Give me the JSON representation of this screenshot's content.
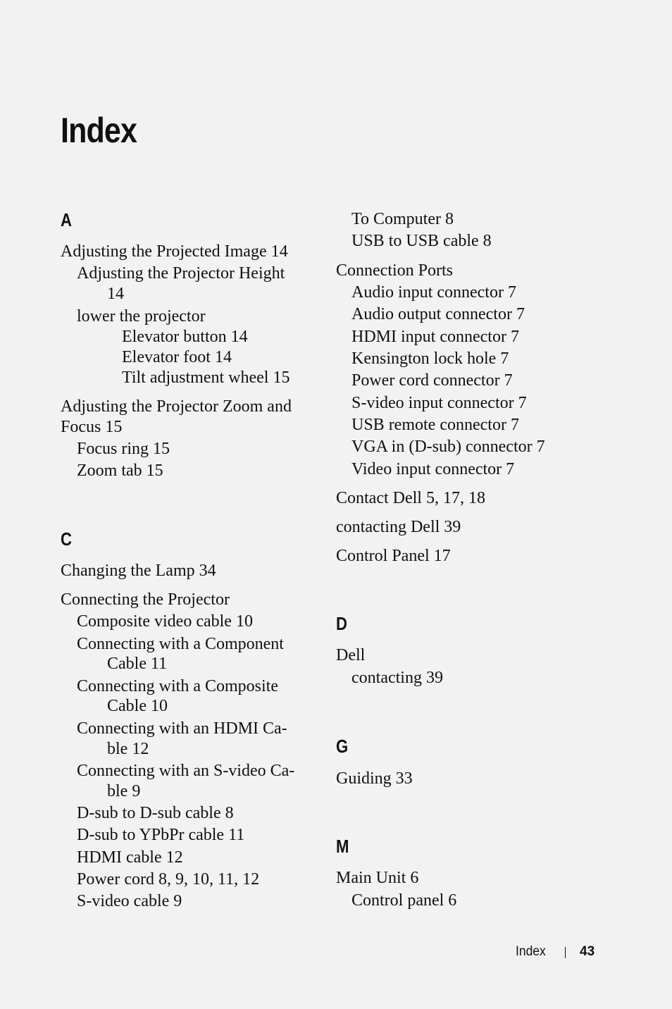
{
  "title": "Index",
  "sections": {
    "A": {
      "letter": "A",
      "lines": [
        "Adjusting the Projected Image 14",
        "Adjusting the Projector Height",
        "14",
        "lower the projector",
        "Elevator button 14",
        "Elevator foot 14",
        "Tilt adjustment wheel 15",
        "Adjusting the Projector Zoom and",
        "Focus 15",
        "Focus ring 15",
        "Zoom tab 15"
      ]
    },
    "C": {
      "letter": "C",
      "lines": [
        "Changing the Lamp 34",
        "Connecting the Projector",
        "Composite video cable 10",
        "Connecting with a Component",
        "Cable 11",
        "Connecting with a Composite",
        "Cable 10",
        "Connecting with an HDMI Ca-",
        "ble 12",
        "Connecting with an S-video Ca-",
        "ble 9",
        "D-sub to D-sub cable 8",
        "D-sub to YPbPr cable 11",
        "HDMI cable 12",
        "Power cord 8, 9, 10, 11, 12",
        "S-video cable 9",
        "To Computer 8",
        "USB to USB cable 8",
        "Connection Ports",
        "Audio input connector 7",
        "Audio output connector 7",
        "HDMI input connector 7",
        "Kensington lock hole 7",
        "Power cord connector 7",
        "S-video input connector 7",
        "USB remote connector 7",
        "VGA in (D-sub) connector 7",
        "Video input connector 7",
        "Contact Dell 5, 17, 18",
        "contacting Dell 39",
        "Control Panel 17"
      ]
    },
    "D": {
      "letter": "D",
      "lines": [
        "Dell",
        "contacting 39"
      ]
    },
    "G": {
      "letter": "G",
      "lines": [
        "Guiding 33"
      ]
    },
    "M": {
      "letter": "M",
      "lines": [
        "Main Unit 6",
        "Control panel 6"
      ]
    }
  },
  "footer": {
    "label": "Index",
    "page": "43"
  }
}
